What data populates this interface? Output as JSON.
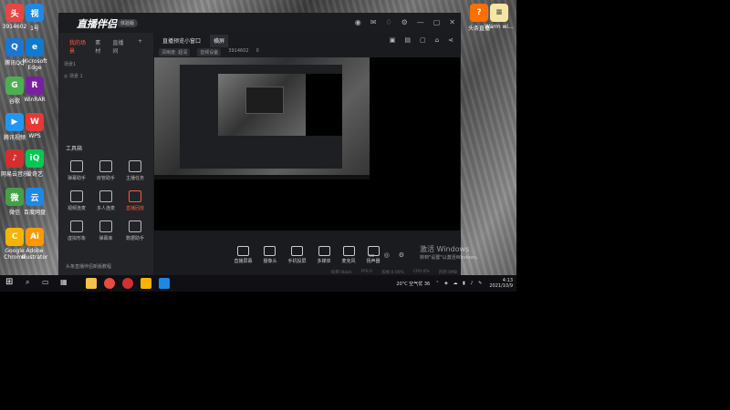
{
  "desktop_icons": [
    {
      "label": "3914602",
      "color": "#e84545",
      "glyph": "头"
    },
    {
      "label": "1号",
      "color": "#1e88e5",
      "glyph": "视"
    },
    {
      "label": "腾讯QQ",
      "color": "#1976d2",
      "glyph": "Q"
    },
    {
      "label": "Microsoft Edge",
      "color": "#0f7bd0",
      "glyph": "e"
    },
    {
      "label": "谷歌",
      "color": "#4caf50",
      "glyph": "G"
    },
    {
      "label": "WinRAR",
      "color": "#7b1fa2",
      "glyph": "R"
    },
    {
      "label": "腾讯视频",
      "color": "#2196f3",
      "glyph": "▶"
    },
    {
      "label": "WPS",
      "color": "#e53935",
      "glyph": "W"
    },
    {
      "label": "网易云音乐",
      "color": "#d32f2f",
      "glyph": "♪"
    },
    {
      "label": "爱奇艺",
      "color": "#00c853",
      "glyph": "iQ"
    },
    {
      "label": "微信",
      "color": "#43a047",
      "glyph": "微"
    },
    {
      "label": "百度网盘",
      "color": "#1e88e5",
      "glyph": "云"
    },
    {
      "label": "Google Chrome",
      "color": "#f4b400",
      "glyph": "C"
    },
    {
      "label": "Adobe Illustrator",
      "color": "#ff9800",
      "glyph": "Ai"
    }
  ],
  "top_icons": [
    {
      "label": "",
      "color": "#2196f3"
    },
    {
      "label": "",
      "color": "#1565c0"
    }
  ],
  "right_icons": [
    {
      "label": "头条直播",
      "color": "#ff6f00"
    },
    {
      "label": "Warm wi...",
      "color": "#f5e6a3"
    }
  ],
  "app": {
    "name": "直播伴侣",
    "badge": "体验版",
    "sidebar_tabs": [
      "我的场景",
      "素材",
      "直播间"
    ],
    "scene_items": [
      "场景1",
      "场景 1"
    ],
    "tools_title": "工具箱",
    "tools": [
      {
        "label": "弹幕助手",
        "highlight": false
      },
      {
        "label": "房管助手",
        "highlight": false
      },
      {
        "label": "主播任务",
        "highlight": false
      },
      {
        "label": "视频连麦",
        "highlight": false
      },
      {
        "label": "多人连麦",
        "highlight": false
      },
      {
        "label": "直播回放",
        "highlight": true
      },
      {
        "label": "虚拟形象",
        "highlight": false
      },
      {
        "label": "弹幕库",
        "highlight": false
      },
      {
        "label": "数据助手",
        "highlight": false
      }
    ],
    "bottom_note": "头条直播伴侣新版教程",
    "main_tabs": [
      "直播预览小窗口",
      "横屏"
    ],
    "meta": [
      "清晰度: 超清",
      "音频设备",
      "3914602",
      "0"
    ],
    "bottom_tools": [
      "直播屏幕",
      "摄像头",
      "手机投屏",
      "多媒体",
      "麦克风",
      "扬声器"
    ],
    "status": [
      "码率:0kb/s",
      "FPS:0",
      "丢帧:0.00%",
      "CPU:0%",
      "内存:0MB"
    ]
  },
  "windows_activation": {
    "line1": "激活 Windows",
    "line2": "转到\"设置\"以激活Windows。"
  },
  "taskbar": {
    "weather": "20°C 空气优 36",
    "time": "4:13",
    "date": "2021/10/9"
  }
}
